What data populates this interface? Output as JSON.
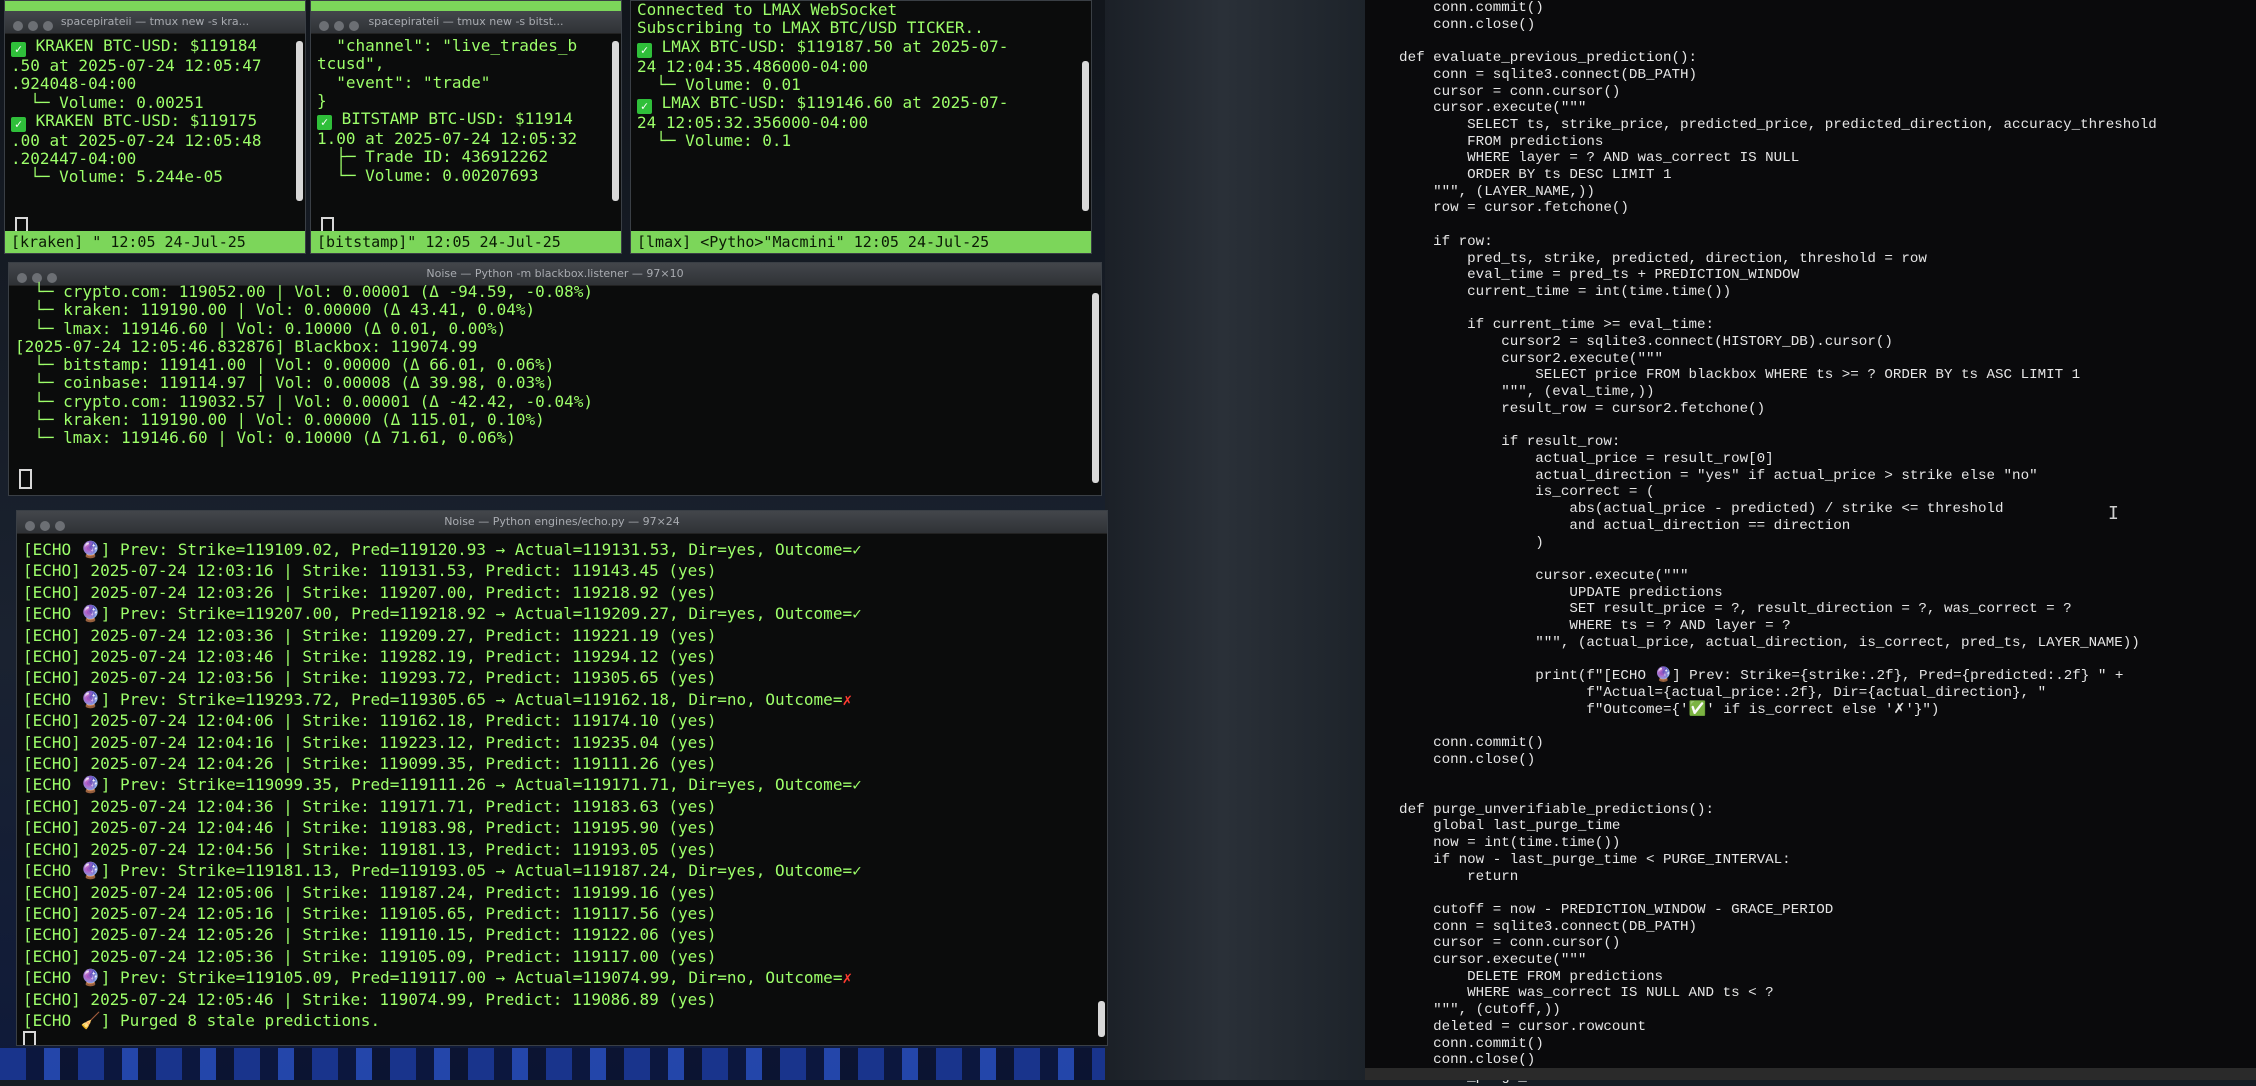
{
  "windows": {
    "kraken": {
      "title": "spacepirateii — tmux new -s kra...",
      "lines": [
        {
          "chk": true,
          "text": " KRAKEN BTC-USD: $119184"
        },
        {
          "chk": false,
          "text": ".50 at 2025-07-24 12:05:47"
        },
        {
          "chk": false,
          "text": ".924048-04:00"
        },
        {
          "chk": false,
          "text": "  └─ Volume: 0.00251"
        },
        {
          "chk": true,
          "text": " KRAKEN BTC-USD: $119175"
        },
        {
          "chk": false,
          "text": ".00 at 2025-07-24 12:05:48"
        },
        {
          "chk": false,
          "text": ".202447-04:00"
        },
        {
          "chk": false,
          "text": "  └─ Volume: 5.244e-05"
        }
      ],
      "status": "[kraken] \" 12:05 24-Jul-25"
    },
    "bitstamp": {
      "title": "spacepirateii — tmux new -s bitst...",
      "lines": [
        {
          "chk": false,
          "text": "  \"channel\": \"live_trades_b"
        },
        {
          "chk": false,
          "text": "tcusd\","
        },
        {
          "chk": false,
          "text": "  \"event\": \"trade\""
        },
        {
          "chk": false,
          "text": "}"
        },
        {
          "chk": true,
          "text": " BITSTAMP BTC-USD: $11914"
        },
        {
          "chk": false,
          "text": "1.00 at 2025-07-24 12:05:32"
        },
        {
          "chk": false,
          "text": "  ├─ Trade ID: 436912262"
        },
        {
          "chk": false,
          "text": "  └─ Volume: 0.00207693"
        }
      ],
      "status": "[bitstamp]\" 12:05 24-Jul-25"
    },
    "lmax": {
      "lines": [
        {
          "chk": false,
          "text": "Connected to LMAX WebSocket"
        },
        {
          "chk": false,
          "text": "Subscribing to LMAX BTC/USD TICKER.."
        },
        {
          "chk": false,
          "text": ""
        },
        {
          "chk": true,
          "text": " LMAX BTC-USD: $119187.50 at 2025-07-"
        },
        {
          "chk": false,
          "text": "24 12:04:35.486000-04:00"
        },
        {
          "chk": false,
          "text": "  └─ Volume: 0.01"
        },
        {
          "chk": true,
          "text": " LMAX BTC-USD: $119146.60 at 2025-07-"
        },
        {
          "chk": false,
          "text": "24 12:05:32.356000-04:00"
        },
        {
          "chk": false,
          "text": "  └─ Volume: 0.1"
        }
      ],
      "status": "[lmax] <Pytho>\"Macmini\" 12:05 24-Jul-25"
    },
    "blackbox": {
      "title": "Noise — Python -m blackbox.listener — 97×10",
      "lines": [
        "  └─ crypto.com: 119052.00 | Vol: 0.00001 (Δ -94.59, -0.08%)",
        "  └─ kraken: 119190.00 | Vol: 0.00000 (Δ 43.41, 0.04%)",
        "  └─ lmax: 119146.60 | Vol: 0.10000 (Δ 0.01, 0.00%)",
        "[2025-07-24 12:05:46.832876] Blackbox: 119074.99",
        "  └─ bitstamp: 119141.00 | Vol: 0.00000 (Δ 66.01, 0.06%)",
        "  └─ coinbase: 119114.97 | Vol: 0.00008 (Δ 39.98, 0.03%)",
        "  └─ crypto.com: 119032.57 | Vol: 0.00001 (Δ -42.42, -0.04%)",
        "  └─ kraken: 119190.00 | Vol: 0.00000 (Δ 115.01, 0.10%)",
        "  └─ lmax: 119146.60 | Vol: 0.10000 (Δ 71.61, 0.06%)"
      ]
    },
    "echo": {
      "title": "Noise — Python engines/echo.py — 97×24",
      "lines": [
        {
          "t": "[ECHO 🔮] Prev: Strike=119109.02, Pred=119120.93 → Actual=119131.53, Dir=yes, Outcome=",
          "m": "✓"
        },
        {
          "t": "[ECHO] 2025-07-24 12:03:16 | Strike: 119131.53, Predict: 119143.45 (yes)",
          "m": ""
        },
        {
          "t": "[ECHO] 2025-07-24 12:03:26 | Strike: 119207.00, Predict: 119218.92 (yes)",
          "m": ""
        },
        {
          "t": "[ECHO 🔮] Prev: Strike=119207.00, Pred=119218.92 → Actual=119209.27, Dir=yes, Outcome=",
          "m": "✓"
        },
        {
          "t": "[ECHO] 2025-07-24 12:03:36 | Strike: 119209.27, Predict: 119221.19 (yes)",
          "m": ""
        },
        {
          "t": "[ECHO] 2025-07-24 12:03:46 | Strike: 119282.19, Predict: 119294.12 (yes)",
          "m": ""
        },
        {
          "t": "[ECHO] 2025-07-24 12:03:56 | Strike: 119293.72, Predict: 119305.65 (yes)",
          "m": ""
        },
        {
          "t": "[ECHO 🔮] Prev: Strike=119293.72, Pred=119305.65 → Actual=119162.18, Dir=no, Outcome=",
          "m": "✗"
        },
        {
          "t": "[ECHO] 2025-07-24 12:04:06 | Strike: 119162.18, Predict: 119174.10 (yes)",
          "m": ""
        },
        {
          "t": "[ECHO] 2025-07-24 12:04:16 | Strike: 119223.12, Predict: 119235.04 (yes)",
          "m": ""
        },
        {
          "t": "[ECHO] 2025-07-24 12:04:26 | Strike: 119099.35, Predict: 119111.26 (yes)",
          "m": ""
        },
        {
          "t": "[ECHO 🔮] Prev: Strike=119099.35, Pred=119111.26 → Actual=119171.71, Dir=yes, Outcome=",
          "m": "✓"
        },
        {
          "t": "[ECHO] 2025-07-24 12:04:36 | Strike: 119171.71, Predict: 119183.63 (yes)",
          "m": ""
        },
        {
          "t": "[ECHO] 2025-07-24 12:04:46 | Strike: 119183.98, Predict: 119195.90 (yes)",
          "m": ""
        },
        {
          "t": "[ECHO] 2025-07-24 12:04:56 | Strike: 119181.13, Predict: 119193.05 (yes)",
          "m": ""
        },
        {
          "t": "[ECHO 🔮] Prev: Strike=119181.13, Pred=119193.05 → Actual=119187.24, Dir=yes, Outcome=",
          "m": "✓"
        },
        {
          "t": "[ECHO] 2025-07-24 12:05:06 | Strike: 119187.24, Predict: 119199.16 (yes)",
          "m": ""
        },
        {
          "t": "[ECHO] 2025-07-24 12:05:16 | Strike: 119105.65, Predict: 119117.56 (yes)",
          "m": ""
        },
        {
          "t": "[ECHO] 2025-07-24 12:05:26 | Strike: 119110.15, Predict: 119122.06 (yes)",
          "m": ""
        },
        {
          "t": "[ECHO] 2025-07-24 12:05:36 | Strike: 119105.09, Predict: 119117.00 (yes)",
          "m": ""
        },
        {
          "t": "[ECHO 🔮] Prev: Strike=119105.09, Pred=119117.00 → Actual=119074.99, Dir=no, Outcome=",
          "m": "✗"
        },
        {
          "t": "[ECHO] 2025-07-24 12:05:46 | Strike: 119074.99, Predict: 119086.89 (yes)",
          "m": ""
        },
        {
          "t": "[ECHO 🧹] Purged 8 stale predictions.",
          "m": ""
        }
      ]
    }
  },
  "editor": {
    "lines": [
      "        conn.commit()",
      "        conn.close()",
      "",
      "    def evaluate_previous_prediction():",
      "        conn = sqlite3.connect(DB_PATH)",
      "        cursor = conn.cursor()",
      "        cursor.execute(\"\"\"",
      "            SELECT ts, strike_price, predicted_price, predicted_direction, accuracy_threshold",
      "            FROM predictions",
      "            WHERE layer = ? AND was_correct IS NULL",
      "            ORDER BY ts DESC LIMIT 1",
      "        \"\"\", (LAYER_NAME,))",
      "        row = cursor.fetchone()",
      "",
      "        if row:",
      "            pred_ts, strike, predicted, direction, threshold = row",
      "            eval_time = pred_ts + PREDICTION_WINDOW",
      "            current_time = int(time.time())",
      "",
      "            if current_time >= eval_time:",
      "                cursor2 = sqlite3.connect(HISTORY_DB).cursor()",
      "                cursor2.execute(\"\"\"",
      "                    SELECT price FROM blackbox WHERE ts >= ? ORDER BY ts ASC LIMIT 1",
      "                \"\"\", (eval_time,))",
      "                result_row = cursor2.fetchone()",
      "",
      "                if result_row:",
      "                    actual_price = result_row[0]",
      "                    actual_direction = \"yes\" if actual_price > strike else \"no\"",
      "                    is_correct = (",
      "                        abs(actual_price - predicted) / strike <= threshold",
      "                        and actual_direction == direction",
      "                    )",
      "",
      "                    cursor.execute(\"\"\"",
      "                        UPDATE predictions",
      "                        SET result_price = ?, result_direction = ?, was_correct = ?",
      "                        WHERE ts = ? AND layer = ?",
      "                    \"\"\", (actual_price, actual_direction, is_correct, pred_ts, LAYER_NAME))",
      "",
      "                    print(f\"[ECHO 🔮] Prev: Strike={strike:.2f}, Pred={predicted:.2f} \" +",
      "                          f\"Actual={actual_price:.2f}, Dir={actual_direction}, \"",
      "                          f\"Outcome={'✅' if is_correct else '✗'}\")",
      "",
      "        conn.commit()",
      "        conn.close()",
      "",
      "",
      "    def purge_unverifiable_predictions():",
      "        global last_purge_time",
      "        now = int(time.time())",
      "        if now - last_purge_time < PURGE_INTERVAL:",
      "            return",
      "",
      "        cutoff = now - PREDICTION_WINDOW - GRACE_PERIOD",
      "        conn = sqlite3.connect(DB_PATH)",
      "        cursor = conn.cursor()",
      "        cursor.execute(\"\"\"",
      "            DELETE FROM predictions",
      "            WHERE was_correct IS NULL AND ts < ?",
      "        \"\"\", (cutoff,))",
      "        deleted = cursor.rowcount",
      "        conn.commit()",
      "        conn.close()",
      "        last_purge_time = now"
    ]
  },
  "colors": {
    "terminal_green": "#9dff6a",
    "status_bar": "#7cd65a",
    "fail_mark": "#ff3b30",
    "ok_check": "#2fbf3a"
  }
}
